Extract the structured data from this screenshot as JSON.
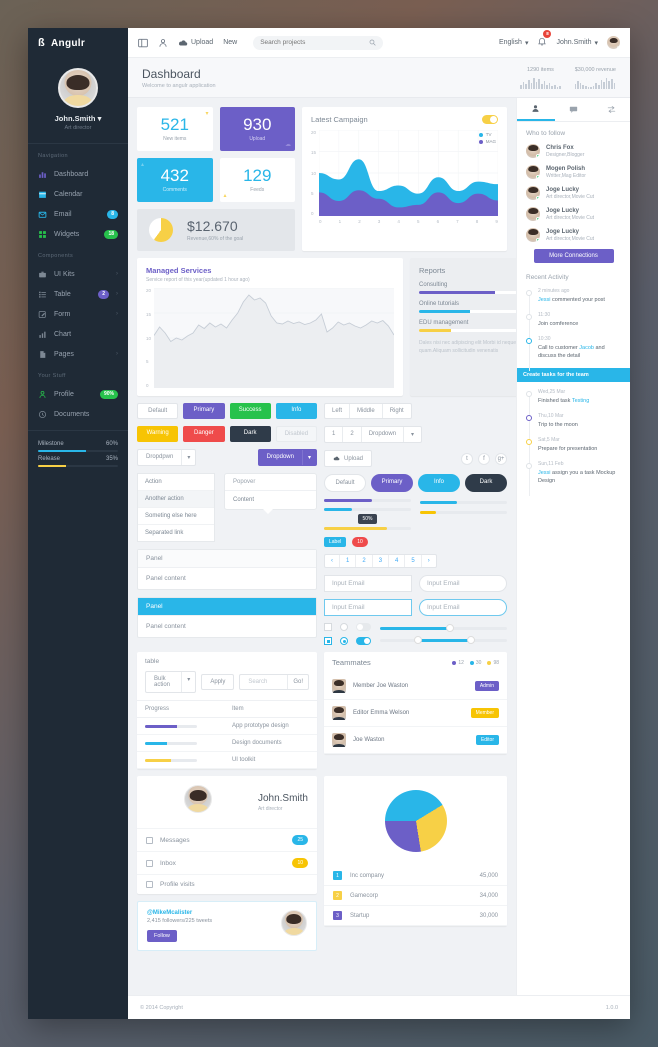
{
  "brand": {
    "mark": "ß",
    "name": "Angulr"
  },
  "sidebar": {
    "profile": {
      "name": "John.Smith",
      "caret": "▾",
      "role": "Art director"
    },
    "sections": [
      {
        "title": "Navigation",
        "items": [
          {
            "label": "Dashboard",
            "icon": "bar-chart-icon",
            "badge": "",
            "badge_color": "",
            "chevron": ""
          },
          {
            "label": "Calendar",
            "icon": "calendar-icon",
            "badge": "",
            "badge_color": "",
            "chevron": ""
          },
          {
            "label": "Email",
            "icon": "envelope-icon",
            "badge": "8",
            "badge_color": "#29b6e8",
            "chevron": ""
          },
          {
            "label": "Widgets",
            "icon": "widgets-icon",
            "badge": "18",
            "badge_color": "#27c24c",
            "chevron": ""
          }
        ]
      },
      {
        "title": "Components",
        "items": [
          {
            "label": "UI Kits",
            "icon": "briefcase-icon",
            "badge": "",
            "badge_color": "",
            "chevron": "›"
          },
          {
            "label": "Table",
            "icon": "list-icon",
            "badge": "2",
            "badge_color": "#6c5fc7",
            "chevron": "›"
          },
          {
            "label": "Form",
            "icon": "pencil-icon",
            "badge": "",
            "badge_color": "",
            "chevron": "›"
          },
          {
            "label": "Chart",
            "icon": "chart-icon",
            "badge": "",
            "badge_color": "",
            "chevron": ""
          },
          {
            "label": "Pages",
            "icon": "file-icon",
            "badge": "",
            "badge_color": "",
            "chevron": "›"
          }
        ]
      },
      {
        "title": "Your Stuff",
        "items": [
          {
            "label": "Profile",
            "icon": "user-icon",
            "badge": "90%",
            "badge_color": "#27c24c",
            "chevron": ""
          },
          {
            "label": "Documents",
            "icon": "clock-icon",
            "badge": "",
            "badge_color": "",
            "chevron": ""
          }
        ]
      }
    ],
    "meters": [
      {
        "label": "Milestone",
        "value": "60%",
        "pct": 60,
        "color": "#29b6e8"
      },
      {
        "label": "Release",
        "value": "35%",
        "pct": 35,
        "color": "#f7d046"
      }
    ]
  },
  "topbar": {
    "upload_label": "Upload",
    "new_label": "New",
    "search_placeholder": "Search projects",
    "language": "English",
    "caret": "▾",
    "notification_count": "8",
    "user": "John.Smith"
  },
  "pageheader": {
    "title": "Dashboard",
    "subtitle": "Welcome to angulr application",
    "stats": [
      {
        "label": "1290 items",
        "bars": [
          4,
          7,
          5,
          9,
          6,
          11,
          7,
          10,
          5,
          8,
          4,
          6,
          3,
          4,
          2,
          3
        ]
      },
      {
        "label": "$30,000 revenue",
        "bars": [
          5,
          8,
          6,
          4,
          3,
          2,
          2,
          3,
          6,
          4,
          9,
          7,
          11,
          8,
          10,
          6
        ]
      }
    ]
  },
  "stats": [
    {
      "value": "521",
      "label": "New items",
      "bg": "#ffffff",
      "fg": "#29b6e8",
      "lbl_fg": "#9aa3ad",
      "corner": "▾",
      "corner_color": "#f7d046"
    },
    {
      "value": "930",
      "label": "Upload",
      "bg": "#6c5fc7",
      "fg": "#ffffff",
      "lbl_fg": "#d7d2f2",
      "corner": "☁",
      "corner_color": "#9a90dd"
    },
    {
      "value": "432",
      "label": "Comments",
      "bg": "#29b6e8",
      "fg": "#ffffff",
      "lbl_fg": "#cfeefb",
      "corner": "▴",
      "corner_color": "#7fd4f2"
    },
    {
      "value": "129",
      "label": "Feeds",
      "bg": "#ffffff",
      "fg": "#29b6e8",
      "lbl_fg": "#9aa3ad",
      "corner": "▴",
      "corner_color": "#f7d046"
    }
  ],
  "revenue": {
    "amount": "$12.670",
    "caption": "Revenue,60% of the goal",
    "pct": 60
  },
  "chart_data": [
    {
      "type": "area",
      "title": "Latest Campaign",
      "x": [
        0,
        1,
        2,
        3,
        4,
        5,
        6,
        7,
        8,
        9
      ],
      "xlabels": [
        "0",
        "1",
        "2",
        "3",
        "4",
        "5",
        "6",
        "7",
        "8",
        "9"
      ],
      "ylabels": [
        "0",
        "5",
        "10",
        "15",
        "20"
      ],
      "ylim": [
        0,
        20
      ],
      "grid": true,
      "legend_position": "top-right",
      "series": [
        {
          "name": "TV",
          "color": "#29b6e8",
          "values": [
            10,
            8.5,
            13.2,
            5.8,
            7.1,
            5.2,
            9.0,
            5.8,
            8.0,
            7.4
          ]
        },
        {
          "name": "MAG",
          "color": "#6c5fc7",
          "values": [
            5.5,
            3.5,
            6.0,
            4.0,
            2.0,
            2.6,
            5.5,
            3.0,
            5.2,
            3.6
          ]
        }
      ]
    },
    {
      "type": "line",
      "title": "Managed Services",
      "subtitle": "Service report of this year(updated 1 hour ago)",
      "ylabels": [
        "0",
        "5",
        "10",
        "15",
        "20"
      ],
      "ylim": [
        0,
        20
      ],
      "grid": true,
      "series": [
        {
          "name": "Services",
          "color": "#c6cdd6",
          "values": [
            10.5,
            12.2,
            11.0,
            9.3,
            10.0,
            9.6,
            10.4,
            11.0,
            12.6,
            11.9,
            13.0,
            12.2,
            12.8,
            12.0,
            13.6,
            15.0,
            17.2,
            18.6,
            17.6,
            18.0,
            17.0,
            14.4,
            13.0,
            12.8,
            13.4,
            12.9,
            13.2,
            12.7,
            13.0,
            13.6,
            14.8,
            11.2,
            12.0,
            13.2,
            12.6,
            13.0,
            12.4,
            12.0,
            12.6,
            13.4,
            13.0,
            13.5,
            12.4,
            10.6
          ]
        }
      ]
    },
    {
      "type": "pie",
      "labels": [
        "Inc company",
        "Gamecorp",
        "Startup"
      ],
      "values": [
        45000,
        34000,
        30000
      ],
      "value_labels": [
        "45,000",
        "34,000",
        "30,000"
      ],
      "colors": [
        "#29b6e8",
        "#f7d046",
        "#6c5fc7"
      ],
      "legend_position": "bottom"
    }
  ],
  "reports": {
    "title": "Reports",
    "rows": [
      {
        "label": "Consulting",
        "value": "60%",
        "pct": 60,
        "color": "#6c5fc7"
      },
      {
        "label": "Online tutorials",
        "value": "40%",
        "pct": 40,
        "color": "#29b6e8"
      },
      {
        "label": "EDU management",
        "value": "25%",
        "pct": 25,
        "color": "#f7d046"
      }
    ],
    "note": "Dales nisi nec adipiscing elit Morbi id neque quam.Aliquam sollicitudin venenatis"
  },
  "buttons": {
    "row1": [
      {
        "label": "Default",
        "class": "default"
      },
      {
        "label": "Primary",
        "color": "#6c5fc7"
      },
      {
        "label": "Success",
        "color": "#27c24c"
      },
      {
        "label": "Info",
        "color": "#29b6e8"
      }
    ],
    "row2": [
      {
        "label": "Warning",
        "color": "#f7c404"
      },
      {
        "label": "Danger",
        "color": "#ef4b4b"
      },
      {
        "label": "Dark",
        "color": "#2f3b49"
      },
      {
        "label": "Disabled",
        "class": "disabled"
      }
    ],
    "rounded": [
      {
        "label": "Default",
        "class": "default"
      },
      {
        "label": "Primary",
        "color": "#6c5fc7"
      },
      {
        "label": "Info",
        "color": "#29b6e8"
      },
      {
        "label": "Dark",
        "color": "#2f3b49"
      }
    ],
    "group_lmr": [
      "Left",
      "Middle",
      "Right"
    ],
    "group_numbers": [
      "1",
      "2",
      "Dropdown"
    ],
    "upload_label": "Upload",
    "social": [
      "twitter-icon",
      "facebook-icon",
      "google-plus-icon"
    ]
  },
  "dropdowns": {
    "left": {
      "label": "Dropdpwn",
      "caret": "▾"
    },
    "right": {
      "label": "Dropdown",
      "caret": "▾",
      "color": "#6c5fc7"
    },
    "menu": [
      "Action",
      "Another action",
      "Someting else here",
      "Separated link"
    ],
    "menu_highlight": 1
  },
  "popover": {
    "header": "Popover",
    "body": "Content"
  },
  "panels": [
    {
      "header": "Panel",
      "body": "Panel content",
      "style": "default"
    },
    {
      "header": "Panel",
      "body": "Panel content",
      "style": "info"
    }
  ],
  "sliders": [
    {
      "fill_pct": 55,
      "color": "#6c5fc7",
      "knob": false
    },
    {
      "fill_pct": 32,
      "color": "#29b6e8",
      "knob": false,
      "tooltip": "50%"
    },
    {
      "fill_pct": 72,
      "color": "#f7d046",
      "knob": false
    },
    {
      "fill_pct": 42,
      "color": "#29b6e8",
      "knob": false
    },
    {
      "fill_pct": 18,
      "color": "#f7c404",
      "knob": false
    },
    {
      "fill_pct": 55,
      "color": "#29b6e8",
      "knob": true
    },
    {
      "fill_pct": 30,
      "color": "#29b6e8",
      "knob": true,
      "knob2_pct": 72
    }
  ],
  "badges": {
    "label": "Label",
    "count": "10"
  },
  "pagination": {
    "prev": "‹",
    "pages": [
      "1",
      "2",
      "3",
      "4",
      "5"
    ],
    "next": "›"
  },
  "inputs": [
    {
      "value": "Input Email",
      "style": "square"
    },
    {
      "value": "Input Email",
      "style": "rounded"
    },
    {
      "value": "Input Email",
      "style": "square-focus"
    },
    {
      "value": "Input Email",
      "style": "rounded-focus"
    }
  ],
  "table": {
    "title": "table",
    "bulk_action": "Bulk action",
    "bulk_caret": "▾",
    "apply_label": "Apply",
    "search_placeholder": "Search",
    "go_label": "Go!",
    "columns": [
      "Progress",
      "Item"
    ],
    "rows": [
      {
        "pct": 62,
        "color": "#6c5fc7",
        "item": "App prototype design"
      },
      {
        "pct": 42,
        "color": "#29b6e8",
        "item": "Design documents"
      },
      {
        "pct": 50,
        "color": "#f7d046",
        "item": "UI toolkit"
      }
    ]
  },
  "teammates": {
    "title": "Teammates",
    "counts": [
      {
        "value": "12",
        "color": "#6c5fc7"
      },
      {
        "value": "30",
        "color": "#29b6e8"
      },
      {
        "value": "98",
        "color": "#f7d046"
      }
    ],
    "rows": [
      {
        "name": "Member Joe Waston",
        "badge": "Admin",
        "badge_color": "#6c5fc7"
      },
      {
        "name": "Editor Emma Welson",
        "badge": "Member",
        "badge_color": "#f7c404"
      },
      {
        "name": "Joe Waston",
        "badge": "Editor",
        "badge_color": "#29b6e8"
      }
    ]
  },
  "profilecard": {
    "name": "John.Smith",
    "role": "Art director",
    "items": [
      {
        "label": "Messages",
        "icon": "comment-icon",
        "badge": "25",
        "badge_color": "#29b6e8"
      },
      {
        "label": "Inbox",
        "icon": "inbox-icon",
        "badge": "10",
        "badge_color": "#f7c404"
      },
      {
        "label": "Profile visits",
        "icon": "eye-icon",
        "badge": "",
        "badge_color": ""
      }
    ]
  },
  "followcard": {
    "handle": "@MikeMcalister",
    "stats": "2,415 followers/225 tweets",
    "button": "Follow"
  },
  "rightbar": {
    "tabs": [
      {
        "icon": "person-icon",
        "active": true
      },
      {
        "icon": "comment-icon",
        "active": false
      },
      {
        "icon": "transfer-icon",
        "active": false
      }
    ],
    "who_to_follow": {
      "title": "Who to follow",
      "people": [
        {
          "name": "Chris Fox",
          "desc": "Designer,Blogger"
        },
        {
          "name": "Mogen Polish",
          "desc": "Writter,Mag Editor"
        },
        {
          "name": "Joge Lucky",
          "desc": "Art director,Movie Cut"
        },
        {
          "name": "Joge Lucky",
          "desc": "Art director,Movie Cut"
        },
        {
          "name": "Joge Lucky",
          "desc": "Art director,Movie Cut"
        }
      ],
      "more_button": "More Connections"
    },
    "recent_activity": {
      "title": "Recent Activity",
      "items": [
        {
          "time": "2 minutes ago",
          "text": "Jessi commented your post",
          "link": "Jessi",
          "node_color": "#dfe3e7",
          "line_color": "#eceef1"
        },
        {
          "time": "11:30",
          "text": "Join comference",
          "link": "",
          "node_color": "#dfe3e7",
          "line_color": "#eceef1"
        },
        {
          "time": "10:30",
          "text": "Call to customer Jacob and discuss the detail",
          "link": "Jacob",
          "node_color": "#29b6e8",
          "line_color": "#29b6e8"
        },
        {
          "time": "Wed,25 Mar",
          "text": "Finished task Testing",
          "link": "Testing",
          "node_color": "#dfe3e7",
          "line_color": "#dfe3e7"
        },
        {
          "time": "Thu,10 Mar",
          "text": "Trip to the moon",
          "link": "",
          "node_color": "#6c5fc7",
          "line_color": "#6c5fc7"
        },
        {
          "time": "Sat,5 Mar",
          "text": "Prepare for presentation",
          "link": "",
          "node_color": "#f7d046",
          "line_color": "#f7d046"
        },
        {
          "time": "Sun,11 Feb",
          "text": "Jessi assign you a task Mockup Design",
          "link": "Jessi",
          "node_color": "#dfe3e7",
          "line_color": "#eceef1"
        }
      ],
      "highlight_bar": "Create tasks for the team"
    }
  },
  "footer": {
    "copyright": "© 2014 Copyright",
    "version": "1.0.0"
  }
}
